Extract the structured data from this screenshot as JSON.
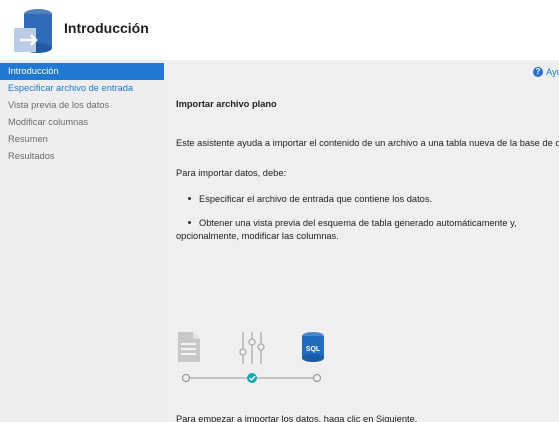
{
  "header": {
    "title": "Introducción",
    "icon": "import-flat-file-icon"
  },
  "sidebar": {
    "items": [
      {
        "label": "Introducción",
        "state": "active"
      },
      {
        "label": "Especificar archivo de entrada",
        "state": "link"
      },
      {
        "label": "Vista previa de los datos",
        "state": "disabled"
      },
      {
        "label": "Modificar columnas",
        "state": "disabled"
      },
      {
        "label": "Resumen",
        "state": "disabled"
      },
      {
        "label": "Resultados",
        "state": "disabled"
      }
    ]
  },
  "main": {
    "help_label": "Ayud",
    "section_title": "Importar archivo plano",
    "intro": "Este asistente ayuda a importar el contenido de un archivo a una tabla nueva de la base de datos",
    "prereq": "Para importar datos, debe:",
    "bullets": [
      "Especificar el archivo de entrada que contiene los datos.",
      "Obtener una vista previa del esquema de tabla generado automáticamente y,",
      "opcionalmente, modificar las columnas."
    ],
    "steps_icons": [
      "document-icon",
      "sliders-icon",
      "sql-database-icon"
    ],
    "sql_label": "SQL",
    "footer": "Para empezar a importar los datos, haga clic en Siguiente."
  },
  "colors": {
    "accent": "#1f78d1",
    "check": "#1aa7b5",
    "sidebar_bg": "#eeeeee",
    "main_bg": "#efefef"
  }
}
